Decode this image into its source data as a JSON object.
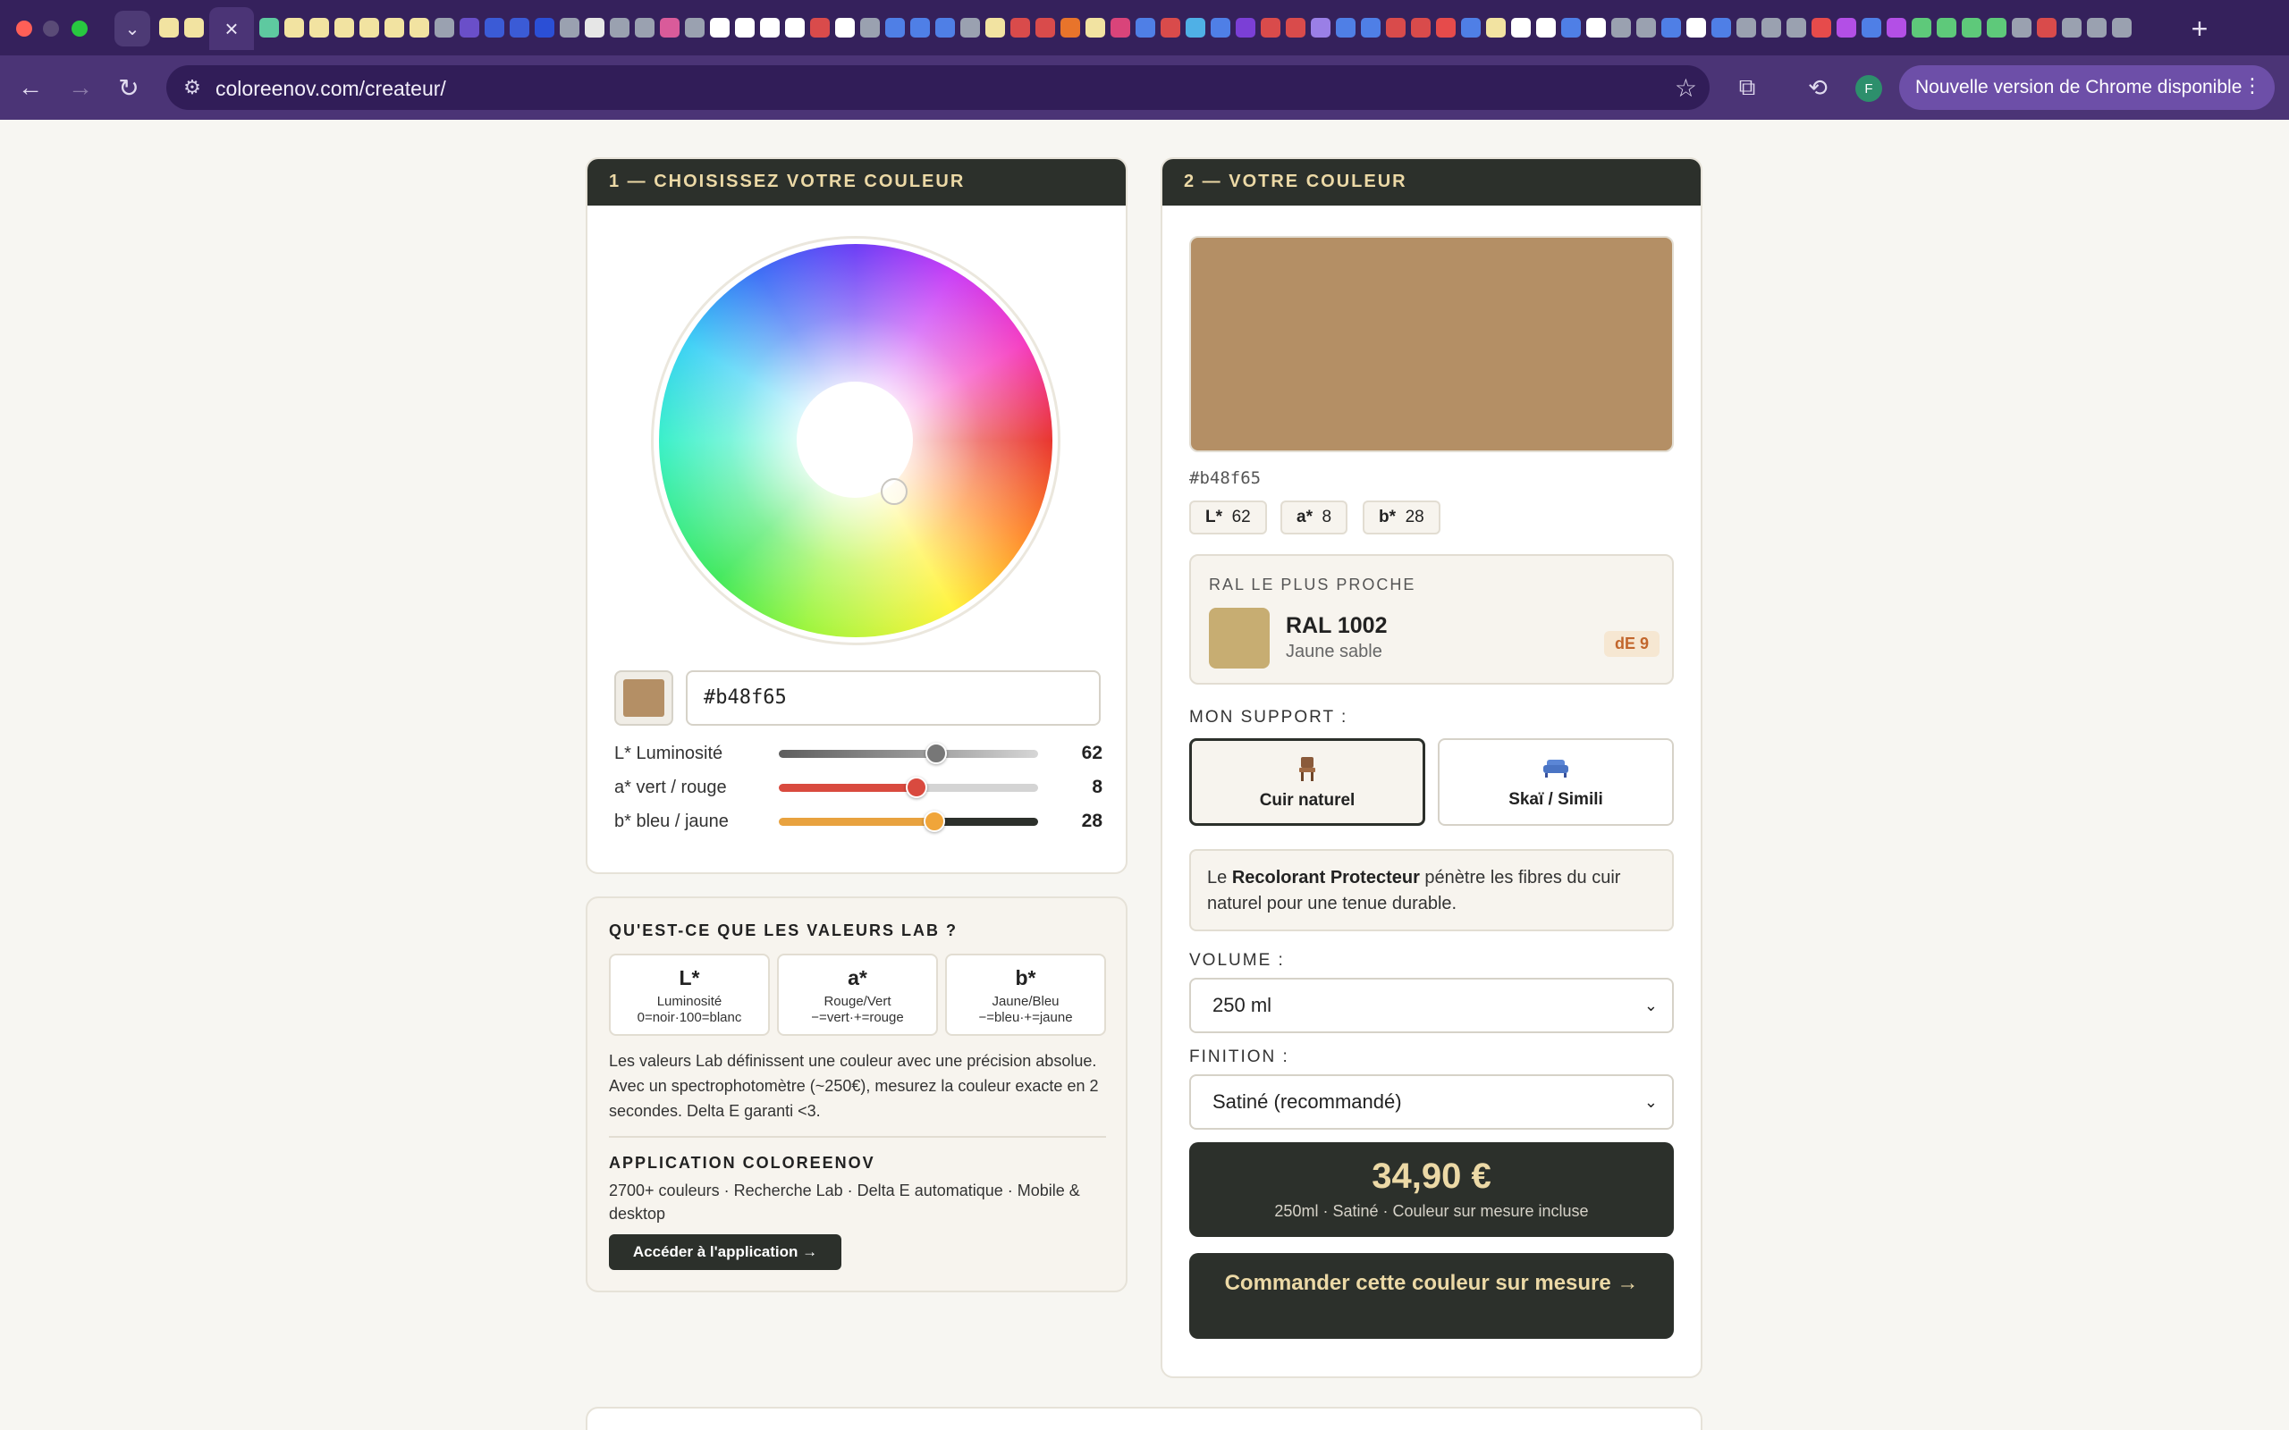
{
  "browser": {
    "url": "coloreenov.com/createur/",
    "update_label": "Nouvelle version de Chrome disponible",
    "profile_initial": "F",
    "favicon_colors": [
      "#f2e3a1",
      "#f2e3a1",
      "#5ec9a0",
      "#5ec9a0",
      "#5ec9a0",
      "#f2e3a1",
      "#f2e3a1",
      "#f2e3a1",
      "#f2e3a1",
      "#f2e3a1",
      "#f2e3a1",
      "#9aa1b0",
      "#6a4fc9",
      "#3b5bd6",
      "#3b5bd6",
      "#2b4fd6",
      "#9aa1b0",
      "#e6e6e6",
      "#9aa1b0",
      "#9aa1b0",
      "#d95b9a",
      "#9aa1b0",
      "#ffffff",
      "#ffffff",
      "#ffffff",
      "#ffffff",
      "#d94b4b",
      "#ffffff",
      "#9aa1b0",
      "#4f7fe6",
      "#4f7fe6",
      "#4f7fe6",
      "#9aa1b0",
      "#f2e3a1",
      "#d94b4b",
      "#d94b4b",
      "#e8742b",
      "#f2e3a1",
      "#d9447a",
      "#4f7fe6",
      "#d94b4b",
      "#4fb0e6",
      "#4f7fe6",
      "#7b3fd6",
      "#d94b4b",
      "#d94b4b",
      "#9a7fe6",
      "#4f7fe6",
      "#4f7fe6",
      "#d94b4b",
      "#d94b4b",
      "#e64b4b",
      "#4f7fe6",
      "#f2e3a1",
      "#ffffff",
      "#ffffff",
      "#4f7fe6",
      "#ffffff",
      "#9aa1b0",
      "#9aa1b0",
      "#4f7fe6",
      "#ffffff",
      "#4f7fe6",
      "#9aa1b0",
      "#9aa1b0",
      "#9aa1b0",
      "#e64b4b",
      "#b34fe6",
      "#4f7fe6",
      "#b34fe6",
      "#5ec97a",
      "#5ec97a",
      "#5ec97a",
      "#5ec97a",
      "#9aa1b0",
      "#d94b4b",
      "#9aa1b0",
      "#9aa1b0",
      "#9aa1b0"
    ]
  },
  "picker": {
    "title": "1 — CHOISISSEZ VOTRE COULEUR",
    "hex_value": "#b48f65",
    "current_color": "#b48f65",
    "sliders": [
      {
        "label": "L* Luminosité",
        "value": "62",
        "fraction": 0.608,
        "track": "linear-gradient(90deg,#5e5e5e 0%,#9a9a9a 55%,#d6d6d6 100%)",
        "thumb": "#777777"
      },
      {
        "label": "a* vert / rouge",
        "value": "8",
        "fraction": 0.53,
        "track": "linear-gradient(90deg,#d94a3f 0%,#d94a3f 53%,#d4d4d4 53%,#d4d4d4 100%)",
        "thumb": "#d94a3f"
      },
      {
        "label": "b* bleu / jaune",
        "value": "28",
        "fraction": 0.6,
        "track": "linear-gradient(90deg,#e8a23f 0%,#e8a23f 60%,#2c302b 60%,#2c302b 100%)",
        "thumb": "#f0a53a"
      }
    ]
  },
  "lab": {
    "title": "QU'EST-CE QUE LES VALEURS LAB ?",
    "boxes": [
      {
        "big": "L*",
        "line1": "Luminosité",
        "line2": "0=noir·100=blanc"
      },
      {
        "big": "a*",
        "line1": "Rouge/Vert",
        "line2": "−=vert·+=rouge"
      },
      {
        "big": "b*",
        "line1": "Jaune/Bleu",
        "line2": "−=bleu·+=jaune"
      }
    ],
    "description": "Les valeurs Lab définissent une couleur avec une précision absolue. Avec un spectrophotomètre (~250€), mesurez la couleur exacte en 2 secondes. Delta E garanti <3.",
    "app_title": "APPLICATION COLOREENOV",
    "app_text": "2700+ couleurs · Recherche Lab · Delta E automatique · Mobile & desktop",
    "app_button": "Accéder à l'application →"
  },
  "result": {
    "title": "2 — VOTRE COULEUR",
    "hex": "#b48f65",
    "color": "#b48f65",
    "chips": [
      {
        "key": "L*",
        "val": "62"
      },
      {
        "key": "a*",
        "val": "8"
      },
      {
        "key": "b*",
        "val": "28"
      }
    ],
    "ral": {
      "title": "RAL LE PLUS PROCHE",
      "code": "RAL 1002",
      "name": "Jaune sable",
      "delta": "dE 9",
      "color": "#c7ad72"
    },
    "support_label": "MON SUPPORT :",
    "supports": [
      {
        "icon": "chair-icon",
        "label": "Cuir naturel",
        "selected": true
      },
      {
        "icon": "sofa-icon",
        "label": "Skaï / Simili",
        "selected": false
      }
    ],
    "info": {
      "prefix": "Le ",
      "bold": "Recolorant Protecteur",
      "suffix": " pénètre les fibres du cuir naturel pour une tenue durable."
    },
    "volume_label": "VOLUME :",
    "volume_value": "250 ml",
    "finish_label": "FINITION :",
    "finish_value": "Satiné (recommandé)",
    "price": "34,90 €",
    "price_sub": "250ml · Satiné · Couleur sur mesure incluse",
    "order_button": "Commander cette couleur sur mesure →"
  }
}
